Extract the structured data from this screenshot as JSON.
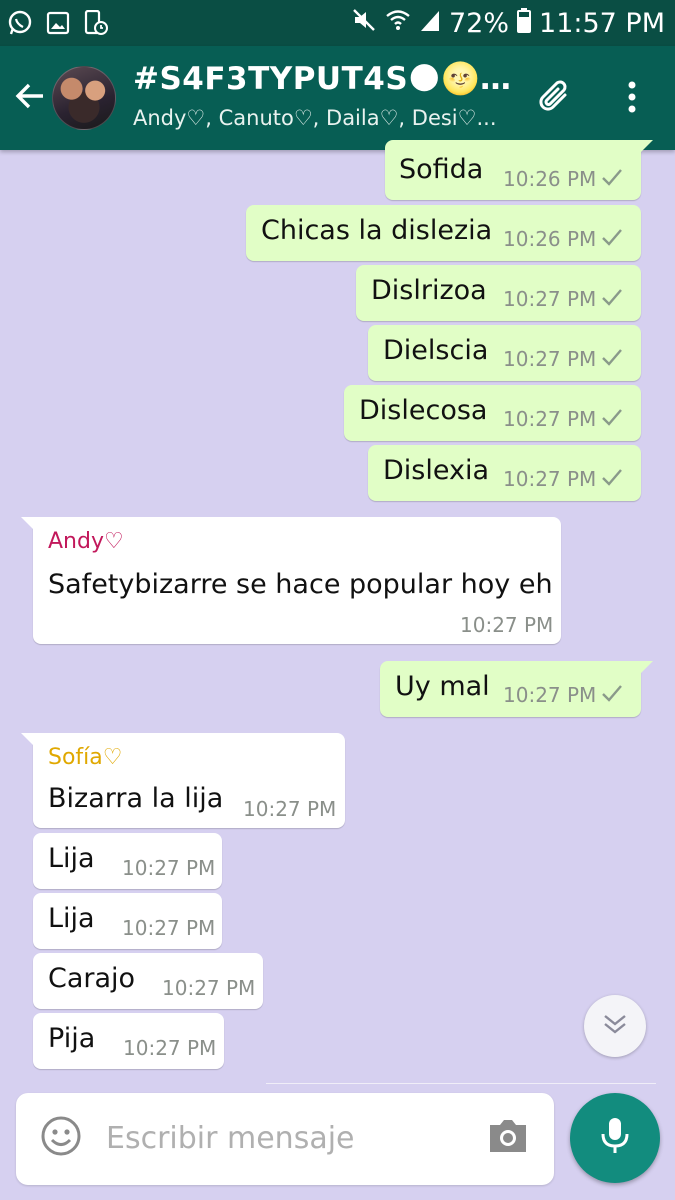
{
  "status_bar": {
    "battery": "72%",
    "time": "11:57 PM"
  },
  "header": {
    "title": "#S4F3TYPUT4S🌑🌝…",
    "subtitle": "Andy♡, Canuto♡, Daila♡, Desi♡..."
  },
  "messages": [
    {
      "text": "Sofida",
      "time": "10:26 PM"
    },
    {
      "text": "Chicas la dislezia",
      "time": "10:26 PM"
    },
    {
      "text": "Dislrizoa",
      "time": "10:27 PM"
    },
    {
      "text": "Dielscia",
      "time": "10:27 PM"
    },
    {
      "text": "Dislecosa",
      "time": "10:27 PM"
    },
    {
      "text": "Dislexia",
      "time": "10:27 PM"
    },
    {
      "sender": "Andy♡",
      "text": "Safetybizarre se hace popular hoy eh",
      "time": "10:27 PM"
    },
    {
      "text": "Uy mal",
      "time": "10:27 PM"
    },
    {
      "sender": "Sofía♡",
      "text": "Bizarra la lija",
      "time": "10:27 PM"
    },
    {
      "text": "Lija",
      "time": "10:27 PM"
    },
    {
      "text": "Lija",
      "time": "10:27 PM"
    },
    {
      "text": "Carajo",
      "time": "10:27 PM"
    },
    {
      "text": "Pija",
      "time": "10:27 PM"
    }
  ],
  "colors": {
    "header": "#075e54",
    "status_bar": "#0a4e44",
    "outgoing_bubble": "#e1fec6",
    "incoming_bubble": "#ffffff",
    "chat_background": "#d6d0f0",
    "andy_name": "#c2185b",
    "sofia_name": "#e0a800",
    "fab": "#128c7e"
  },
  "input": {
    "placeholder": "Escribir mensaje"
  },
  "icons": {
    "back": "arrow-left-icon",
    "attach": "paperclip-icon",
    "menu": "more-vert-icon",
    "emoji": "smiley-icon",
    "camera": "camera-icon",
    "mic": "microphone-icon",
    "scroll": "double-chevron-down-icon"
  }
}
